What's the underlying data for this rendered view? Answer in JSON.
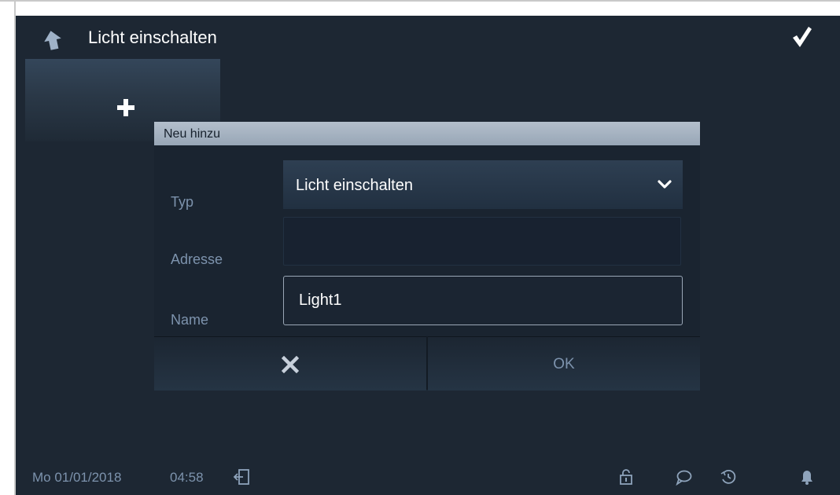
{
  "header": {
    "title": "Licht einschalten",
    "back_icon": "back-arrow-icon",
    "confirm_icon": "checkmark-icon"
  },
  "add_tile": {
    "icon": "plus-icon"
  },
  "dialog": {
    "title": "Neu hinzu",
    "type_label": "Typ",
    "type_value": "Licht einschalten",
    "address_label": "Adresse",
    "address_value": "",
    "name_label": "Name",
    "name_value": "Light1",
    "cancel_icon": "close-icon",
    "ok_label": "OK"
  },
  "status_bar": {
    "date": "Mo 01/01/2018",
    "time": "04:58",
    "icons": [
      "logout-icon",
      "lock-icon",
      "chat-icon",
      "history-icon",
      "bell-icon"
    ]
  },
  "colors": {
    "background": "#1d2733",
    "dialog_header": "#a7b4c3",
    "label_text": "#7d93ad",
    "primary_text": "#ffffff"
  }
}
